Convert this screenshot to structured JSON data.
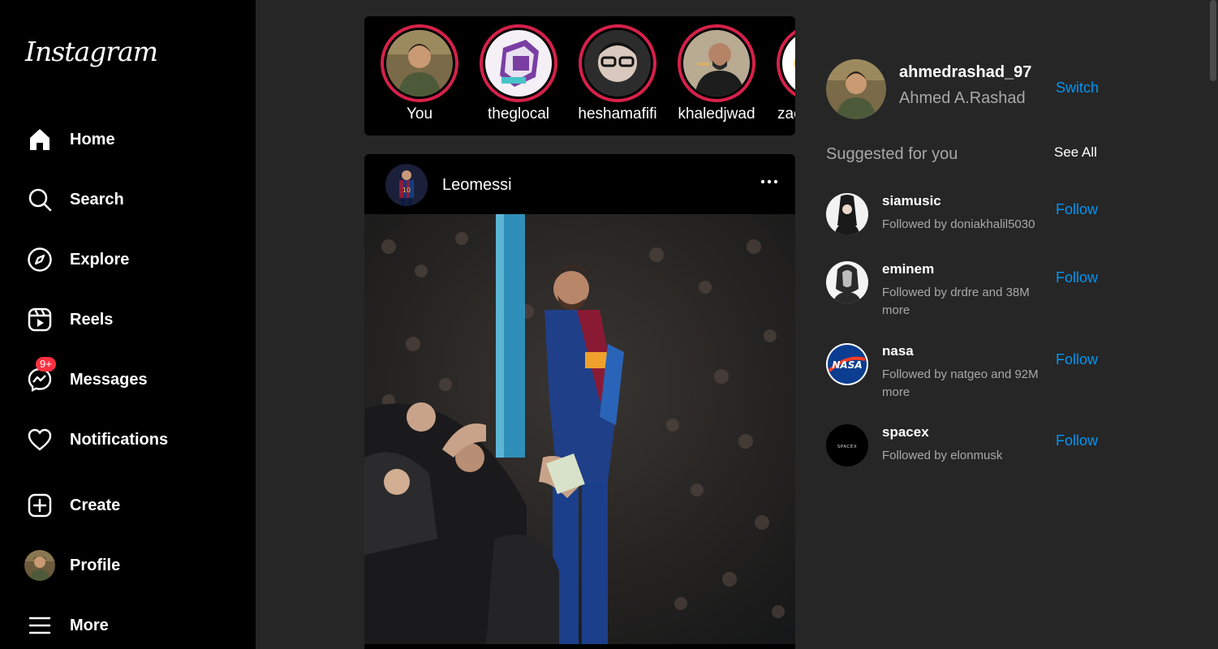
{
  "app": {
    "logo_text": "Instagram"
  },
  "sidebar": {
    "items": [
      {
        "label": "Home",
        "icon": "home-icon"
      },
      {
        "label": "Search",
        "icon": "search-icon"
      },
      {
        "label": "Explore",
        "icon": "compass-icon"
      },
      {
        "label": "Reels",
        "icon": "reels-icon"
      },
      {
        "label": "Messages",
        "icon": "messenger-icon",
        "badge": "9+"
      },
      {
        "label": "Notifications",
        "icon": "heart-icon"
      },
      {
        "label": "Create",
        "icon": "plus-square-icon"
      },
      {
        "label": "Profile",
        "icon": "avatar"
      },
      {
        "label": "More",
        "icon": "menu-icon"
      }
    ]
  },
  "stories": [
    {
      "name": "You"
    },
    {
      "name": "theglocal"
    },
    {
      "name": "heshamafifi"
    },
    {
      "name": "khaledjwad"
    },
    {
      "name": "zac"
    }
  ],
  "post": {
    "username": "Leomessi",
    "more_icon": "more-horizontal-icon"
  },
  "current_user": {
    "username": "ahmedrashad_97",
    "full_name": "Ahmed A.Rashad",
    "switch_label": "Switch"
  },
  "suggestions": {
    "title": "Suggested for you",
    "see_all_label": "See All",
    "items": [
      {
        "username": "siamusic",
        "subtitle": "Followed by doniakhalil5030",
        "follow_label": "Follow"
      },
      {
        "username": "eminem",
        "subtitle": "Followed by drdre and 38M more",
        "follow_label": "Follow"
      },
      {
        "username": "nasa",
        "subtitle": "Followed by natgeo and 92M more",
        "follow_label": "Follow",
        "avatar_text": "NASA"
      },
      {
        "username": "spacex",
        "subtitle": "Followed by elonmusk",
        "follow_label": "Follow",
        "avatar_text": "SPACEX"
      }
    ]
  },
  "colors": {
    "accent": "#0095f6",
    "story_ring": "#d6214a",
    "badge": "#ff3040",
    "background": "#262626",
    "sidebar": "#000000"
  }
}
